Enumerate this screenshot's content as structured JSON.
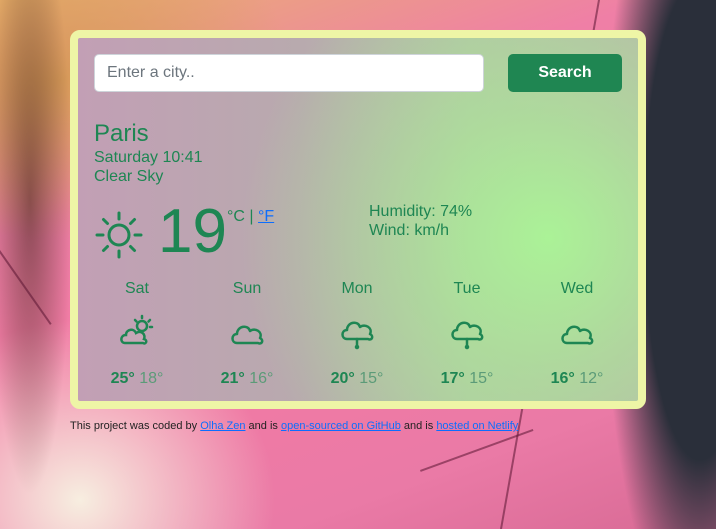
{
  "search": {
    "placeholder": "Enter a city..",
    "button_label": "Search"
  },
  "current": {
    "city": "Paris",
    "date": "Saturday 10:41",
    "description": "Clear Sky",
    "icon": "sun-icon",
    "temperature": "19",
    "unit_c": "°C",
    "unit_separator": "|",
    "unit_f": "°F",
    "humidity": "Humidity: 74%",
    "wind": "Wind: km/h"
  },
  "forecast": [
    {
      "day": "Sat",
      "icon": "partly-cloudy-icon",
      "max": "25°",
      "min": "18°"
    },
    {
      "day": "Sun",
      "icon": "cloud-icon",
      "max": "21°",
      "min": "16°"
    },
    {
      "day": "Mon",
      "icon": "rain-cloud-icon",
      "max": "20°",
      "min": "15°"
    },
    {
      "day": "Tue",
      "icon": "rain-cloud-icon",
      "max": "17°",
      "min": "15°"
    },
    {
      "day": "Wed",
      "icon": "cloud-icon",
      "max": "16°",
      "min": "12°"
    }
  ],
  "footer": {
    "text_1": "This project was coded by",
    "author_link": "Olha Zen",
    "text_2": "and is",
    "github_link": "open-sourced on GitHub",
    "text_3": "and is",
    "netlify_link": "hosted on Netlify"
  },
  "colors": {
    "accent": "#1e8653",
    "button": "#1f8652",
    "card_border": "#eef5a6",
    "link": "#0d6efd"
  }
}
